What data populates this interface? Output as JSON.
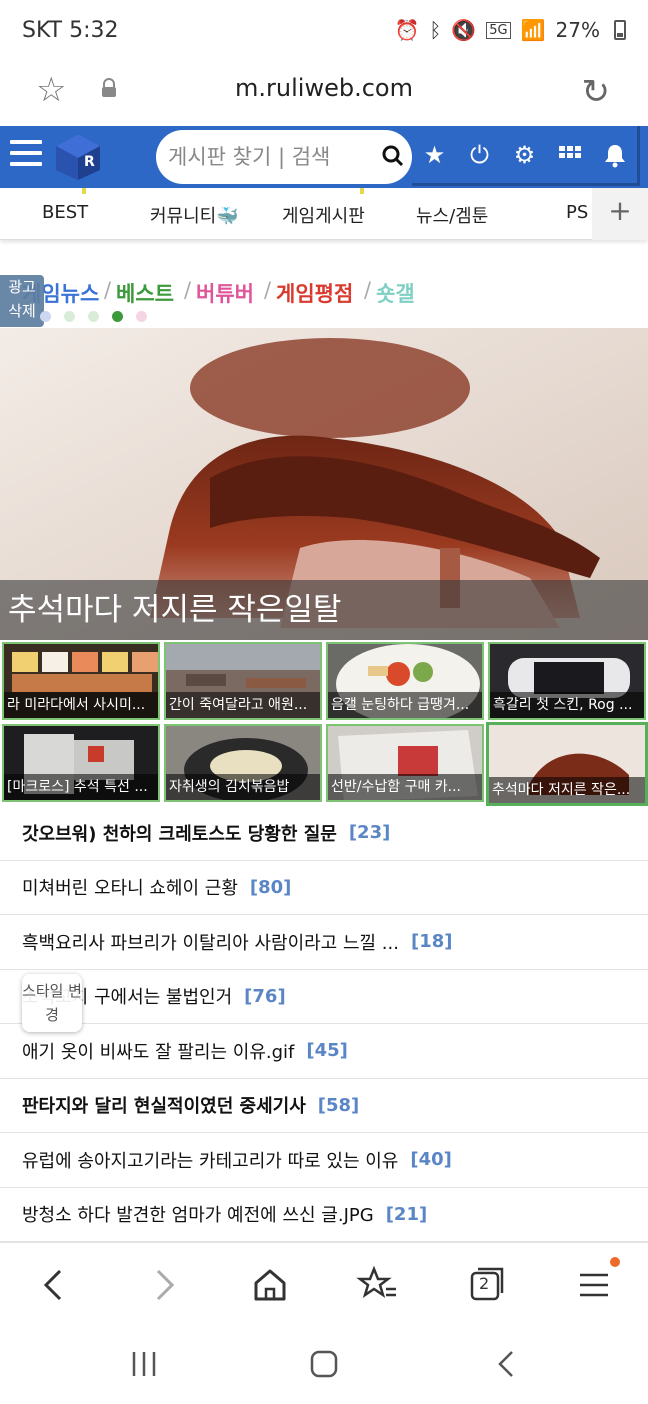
{
  "status_bar": {
    "carrier_time": "SKT 5:32",
    "network": "5G",
    "battery": "27%",
    "battery_level": 0.27
  },
  "browser": {
    "url": "m.ruliweb.com",
    "tab_count": "2"
  },
  "site_header": {
    "search_placeholder": "게시판 찾기 | 검색",
    "accent_color": "#2e68c6"
  },
  "category_nav": {
    "items": [
      "BEST",
      "커뮤니티",
      "게임게시판",
      "뉴스/겜툰",
      "PS"
    ],
    "more": "+"
  },
  "ad_badge": "광고 삭제",
  "quick_links": [
    {
      "label": "게임뉴스",
      "color": "#3a72d8"
    },
    {
      "label": "베스트",
      "color": "#3c9a3c"
    },
    {
      "label": "버튜버",
      "color": "#e0559a"
    },
    {
      "label": "게임평점",
      "color": "#d83a2e"
    },
    {
      "label": "숏갤",
      "color": "#7fd0c4"
    }
  ],
  "quick_link_separator": "/",
  "carousel_dots": [
    "#cdd8f0",
    "#d8ecd8",
    "#d8ecd8",
    "#3c9a3c",
    "#f5d4e4"
  ],
  "hero": {
    "caption": "추석마다 저지른 작은일탈"
  },
  "thumbnails": [
    {
      "caption": "라 미라다에서 사시미...",
      "image": "sushi platter"
    },
    {
      "caption": "간이 죽여달라고 애원...",
      "image": "cloudy sky building"
    },
    {
      "caption": "음갤 눈팅하다 급땡겨...",
      "image": "salad plate"
    },
    {
      "caption": "흑갈리 첫 스킨, Rog ...",
      "image": "handheld console"
    },
    {
      "caption": "[마크로스] 추석 특선 ...",
      "image": "robot model"
    },
    {
      "caption": "자취생의 김치볶음밥",
      "image": "wok fried rice"
    },
    {
      "caption": "선반/수납함 구매 카...",
      "image": "cardboard box"
    },
    {
      "caption": "추석마다 저지른 작은...",
      "image": "grilled ribs"
    }
  ],
  "articles": [
    {
      "title": "갓오브워) 천하의 크레토스도 당황한 질문",
      "count": "[23]",
      "bold": true
    },
    {
      "title": "미쳐버린 오타니 쇼헤이 근황",
      "count": "[80]",
      "bold": false
    },
    {
      "title": "흑백요리사 파브리가 이탈리아 사람이라고 느낄 ...",
      "count": "[18]",
      "bold": false
    },
    {
      "title": "소떡꼬치 구에서는 불법인거",
      "count": "[76]",
      "bold": false
    },
    {
      "title": "애기 옷이 비싸도 잘 팔리는 이유.gif",
      "count": "[45]",
      "bold": false
    },
    {
      "title": "판타지와 달리 현실적이였던 중세기사",
      "count": "[58]",
      "bold": true
    },
    {
      "title": "유럽에 송아지고기라는 카테고리가 따로 있는 이유",
      "count": "[40]",
      "bold": false
    },
    {
      "title": "방청소 하다 발견한 엄마가 예전에 쓰신 글.JPG",
      "count": "[21]",
      "bold": false
    }
  ],
  "font_button": "스타일 변경"
}
